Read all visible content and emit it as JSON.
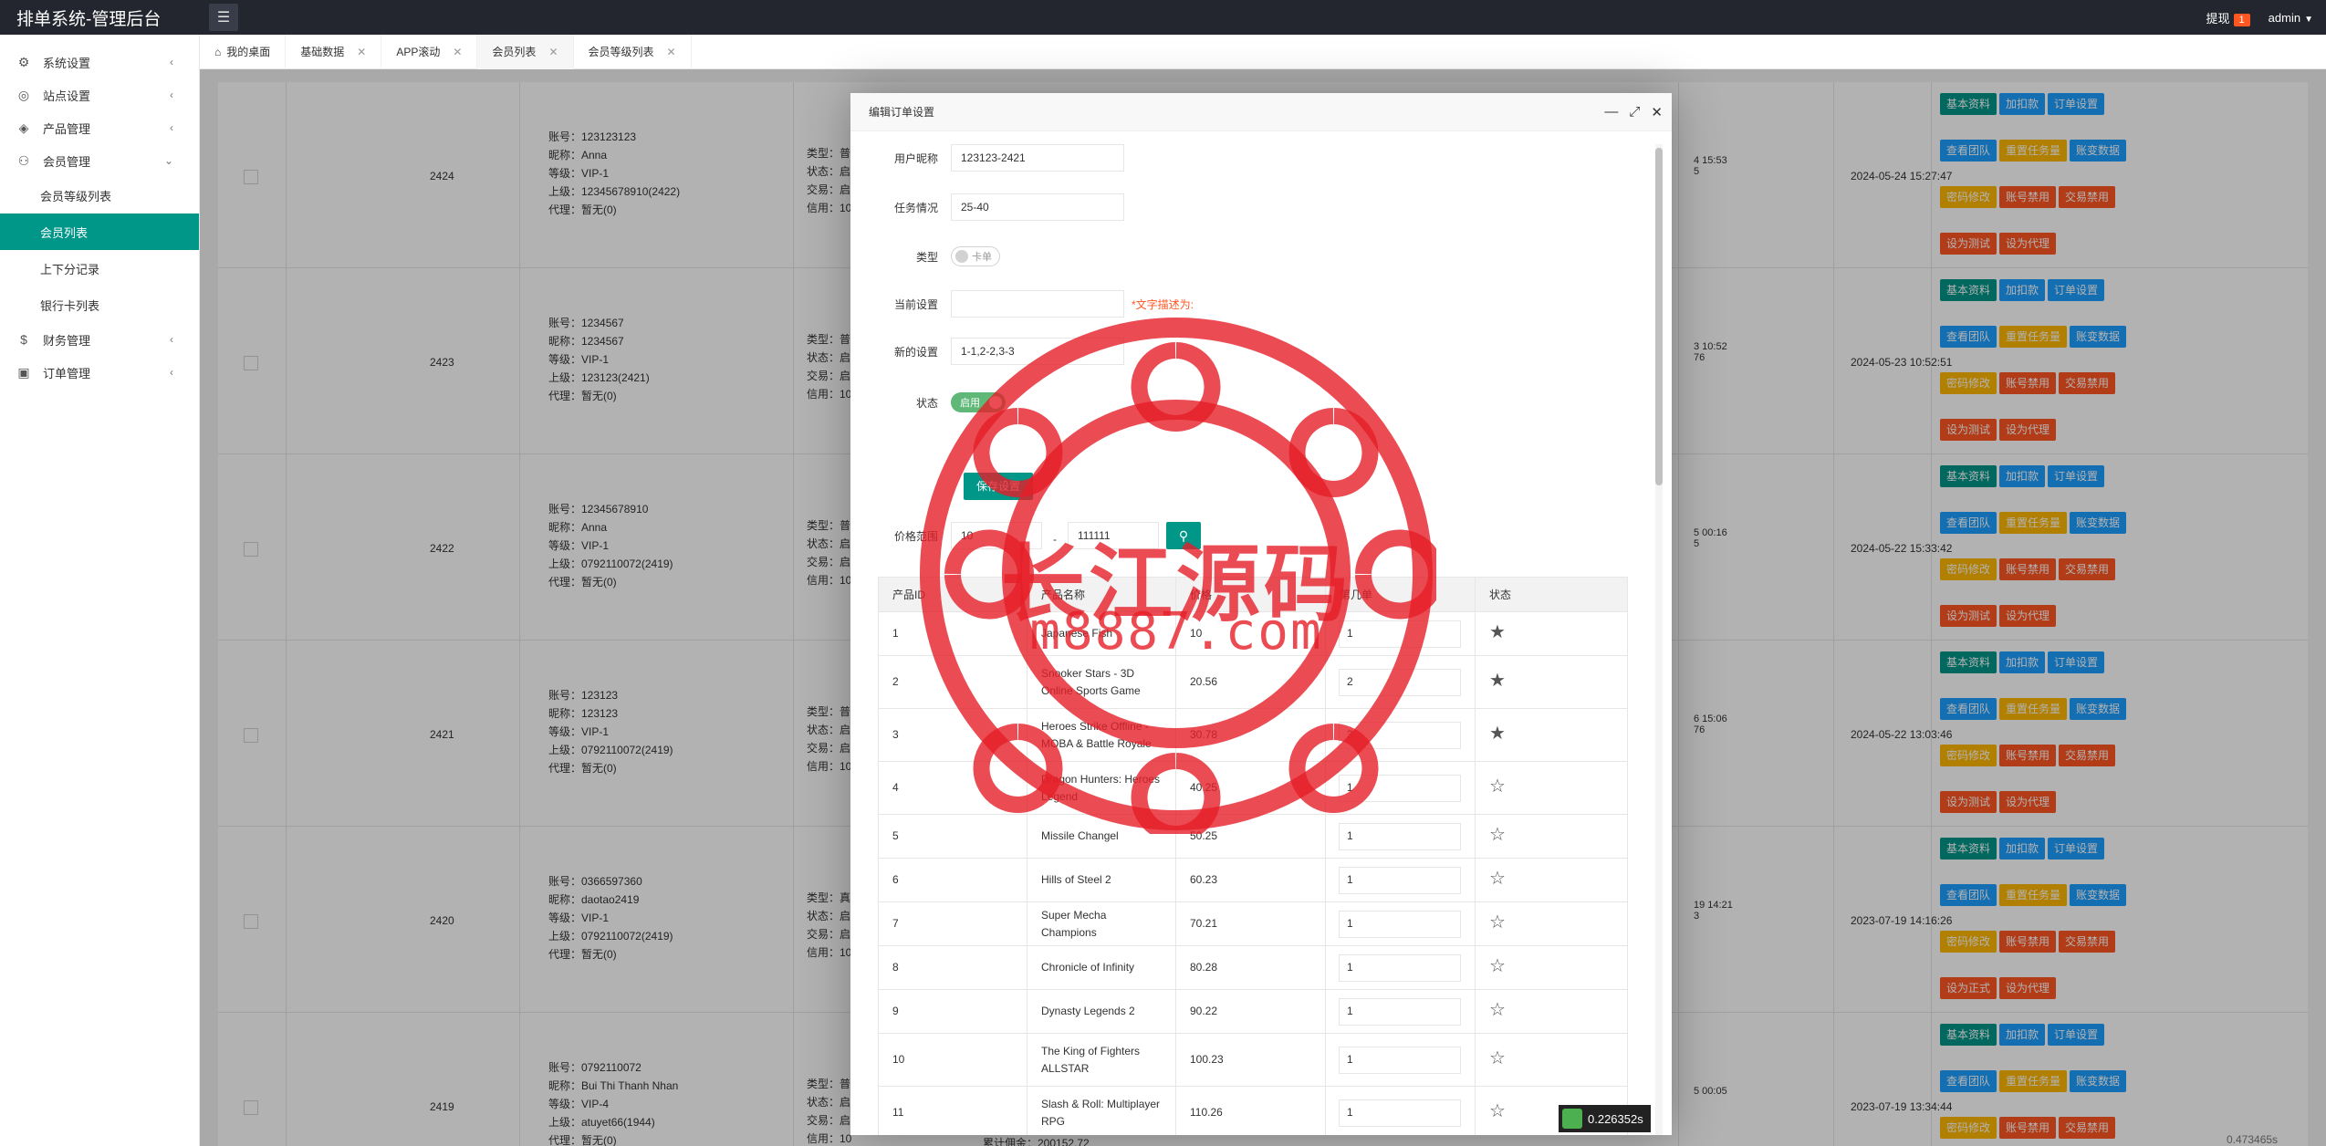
{
  "app": {
    "title": "排单系统-管理后台",
    "notice_label": "提现",
    "notice_count": "1",
    "user": "admin"
  },
  "sidebar": {
    "items": [
      {
        "label": "系统设置",
        "icon": "gear-icon"
      },
      {
        "label": "站点设置",
        "icon": "globe-icon"
      },
      {
        "label": "产品管理",
        "icon": "cube-icon"
      },
      {
        "label": "会员管理",
        "icon": "user-icon"
      },
      {
        "label": "财务管理",
        "icon": "dollar-icon"
      },
      {
        "label": "订单管理",
        "icon": "box-icon"
      }
    ],
    "member_sub": [
      "会员等级列表",
      "会员列表",
      "上下分记录",
      "银行卡列表"
    ]
  },
  "tabs": [
    "我的桌面",
    "基础数据",
    "APP滚动",
    "会员列表",
    "会员等级列表"
  ],
  "bg_rows": [
    {
      "id": "2424",
      "info": [
        "账号：123123123",
        "昵称：Anna",
        "等级：VIP-1",
        "上级：12345678910(2422)",
        "代理：暂无(0)"
      ],
      "info2": [
        "类型：普",
        "状态：启",
        "交易：启",
        "信用：10"
      ],
      "date1": "4 15:53",
      "date1b": "5",
      "date": "2024-05-24 15:27:47",
      "ops": [
        [
          "基本资料",
          "g"
        ],
        [
          "加扣款",
          "b"
        ],
        [
          "订单设置",
          "b"
        ],
        [
          "查看团队",
          "b"
        ],
        [
          "重置任务量",
          "o"
        ],
        [
          "账变数据",
          "b"
        ],
        [
          "密码修改",
          "o"
        ],
        [
          "账号禁用",
          "r"
        ],
        [
          "交易禁用",
          "r"
        ],
        [
          "设为测试",
          "r"
        ],
        [
          "设为代理",
          "r"
        ]
      ]
    },
    {
      "id": "2423",
      "info": [
        "账号：1234567",
        "昵称：1234567",
        "等级：VIP-1",
        "上级：123123(2421)",
        "代理：暂无(0)"
      ],
      "info2": [
        "类型：普",
        "状态：启",
        "交易：启",
        "信用：10"
      ],
      "date1": "3 10:52",
      "date1b": "76",
      "date": "2024-05-23 10:52:51",
      "ops": [
        [
          "基本资料",
          "g"
        ],
        [
          "加扣款",
          "b"
        ],
        [
          "订单设置",
          "b"
        ],
        [
          "查看团队",
          "b"
        ],
        [
          "重置任务量",
          "o"
        ],
        [
          "账变数据",
          "b"
        ],
        [
          "密码修改",
          "o"
        ],
        [
          "账号禁用",
          "r"
        ],
        [
          "交易禁用",
          "r"
        ],
        [
          "设为测试",
          "r"
        ],
        [
          "设为代理",
          "r"
        ]
      ]
    },
    {
      "id": "2422",
      "info": [
        "账号：12345678910",
        "昵称：Anna",
        "等级：VIP-1",
        "上级：0792110072(2419)",
        "代理：暂无(0)"
      ],
      "info2": [
        "类型：普",
        "状态：启",
        "交易：启",
        "信用：10"
      ],
      "date1": "5 00:16",
      "date1b": "5",
      "date": "2024-05-22 15:33:42",
      "ops": [
        [
          "基本资料",
          "g"
        ],
        [
          "加扣款",
          "b"
        ],
        [
          "订单设置",
          "b"
        ],
        [
          "查看团队",
          "b"
        ],
        [
          "重置任务量",
          "o"
        ],
        [
          "账变数据",
          "b"
        ],
        [
          "密码修改",
          "o"
        ],
        [
          "账号禁用",
          "r"
        ],
        [
          "交易禁用",
          "r"
        ],
        [
          "设为测试",
          "r"
        ],
        [
          "设为代理",
          "r"
        ]
      ]
    },
    {
      "id": "2421",
      "info": [
        "账号：123123",
        "昵称：123123",
        "等级：VIP-1",
        "上级：0792110072(2419)",
        "代理：暂无(0)"
      ],
      "info2": [
        "类型：普",
        "状态：启",
        "交易：启",
        "信用：10"
      ],
      "date1": "6 15:06",
      "date1b": "76",
      "date": "2024-05-22 13:03:46",
      "ops": [
        [
          "基本资料",
          "g"
        ],
        [
          "加扣款",
          "b"
        ],
        [
          "订单设置",
          "b"
        ],
        [
          "查看团队",
          "b"
        ],
        [
          "重置任务量",
          "o"
        ],
        [
          "账变数据",
          "b"
        ],
        [
          "密码修改",
          "o"
        ],
        [
          "账号禁用",
          "r"
        ],
        [
          "交易禁用",
          "r"
        ],
        [
          "设为测试",
          "r"
        ],
        [
          "设为代理",
          "r"
        ]
      ]
    },
    {
      "id": "2420",
      "info": [
        "账号：0366597360",
        "昵称：daotao2419",
        "等级：VIP-1",
        "上级：0792110072(2419)",
        "代理：暂无(0)"
      ],
      "info2": [
        "类型：真",
        "状态：启",
        "交易：启",
        "信用：10"
      ],
      "date1": "19 14:21",
      "date1b": "3",
      "date": "2023-07-19 14:16:26",
      "ops": [
        [
          "基本资料",
          "g"
        ],
        [
          "加扣款",
          "b"
        ],
        [
          "订单设置",
          "b"
        ],
        [
          "查看团队",
          "b"
        ],
        [
          "重置任务量",
          "o"
        ],
        [
          "账变数据",
          "b"
        ],
        [
          "密码修改",
          "o"
        ],
        [
          "账号禁用",
          "r"
        ],
        [
          "交易禁用",
          "r"
        ],
        [
          "设为正式",
          "r"
        ],
        [
          "设为代理",
          "r"
        ]
      ]
    },
    {
      "id": "2419",
      "info": [
        "账号：0792110072",
        "昵称：Bui Thi Thanh Nhan",
        "等级：VIP-4",
        "上级：atuyet66(1944)",
        "代理：暂无(0)"
      ],
      "info2": [
        "类型：普",
        "状态：启",
        "交易：启",
        "信用：10"
      ],
      "date1": "5 00:05",
      "date1b": "",
      "date": "2023-07-19 13:34:44",
      "ops": [
        [
          "基本资料",
          "g"
        ],
        [
          "加扣款",
          "b"
        ],
        [
          "订单设置",
          "b"
        ],
        [
          "查看团队",
          "b"
        ],
        [
          "重置任务量",
          "o"
        ],
        [
          "账变数据",
          "b"
        ],
        [
          "密码修改",
          "o"
        ],
        [
          "账号禁用",
          "r"
        ],
        [
          "交易禁用",
          "r"
        ]
      ]
    }
  ],
  "bg_footer": "累计佣金：200152.72",
  "modal": {
    "title": "编辑订单设置",
    "fields": {
      "nickname_label": "用户昵称",
      "nickname_value": "123123-2421",
      "task_label": "任务情况",
      "task_value": "25-40",
      "type_label": "类型",
      "type_switch": "卡单",
      "current_label": "当前设置",
      "current_value": "",
      "current_hint": "*文字描述为:",
      "new_label": "新的设置",
      "new_value": "1-1,2-2,3-3",
      "status_label": "状态",
      "status_switch": "启用",
      "save_label": "保存设置",
      "price_label": "价格范围",
      "price_min": "10",
      "price_sep": "-",
      "price_max": "111111"
    },
    "table": {
      "headers": [
        "产品ID",
        "产品名称",
        "价格",
        "第几单",
        "状态"
      ],
      "rows": [
        {
          "id": "1",
          "name": "Japanese Fish",
          "price": "10",
          "qty": "1",
          "star": true
        },
        {
          "id": "2",
          "name": "Snooker Stars - 3D Online Sports Game",
          "price": "20.56",
          "qty": "2",
          "star": true
        },
        {
          "id": "3",
          "name": "Heroes Strike Offline - MOBA & Battle Royale",
          "price": "30.78",
          "qty": "3",
          "star": true
        },
        {
          "id": "4",
          "name": "Dragon Hunters: Heroes Legend",
          "price": "40.25",
          "qty": "1",
          "star": false
        },
        {
          "id": "5",
          "name": "Missile Changel",
          "price": "50.25",
          "qty": "1",
          "star": false
        },
        {
          "id": "6",
          "name": "Hills of Steel 2",
          "price": "60.23",
          "qty": "1",
          "star": false
        },
        {
          "id": "7",
          "name": "Super Mecha Champions",
          "price": "70.21",
          "qty": "1",
          "star": false
        },
        {
          "id": "8",
          "name": "Chronicle of Infinity",
          "price": "80.28",
          "qty": "1",
          "star": false
        },
        {
          "id": "9",
          "name": "Dynasty Legends 2",
          "price": "90.22",
          "qty": "1",
          "star": false
        },
        {
          "id": "10",
          "name": "The King of Fighters ALLSTAR",
          "price": "100.23",
          "qty": "1",
          "star": false
        },
        {
          "id": "11",
          "name": "Slash & Roll: Multiplayer RPG",
          "price": "110.26",
          "qty": "1",
          "star": false
        }
      ]
    }
  },
  "watermark": {
    "line1": "长江源码",
    "line2": "m8887.com"
  },
  "timer": {
    "value": "0.226352s",
    "value2": "0.473465s"
  },
  "colors": {
    "teal": "#009688",
    "blue": "#1e9fff",
    "orange": "#ffb800",
    "red": "#ff5722",
    "header": "#23262e"
  }
}
